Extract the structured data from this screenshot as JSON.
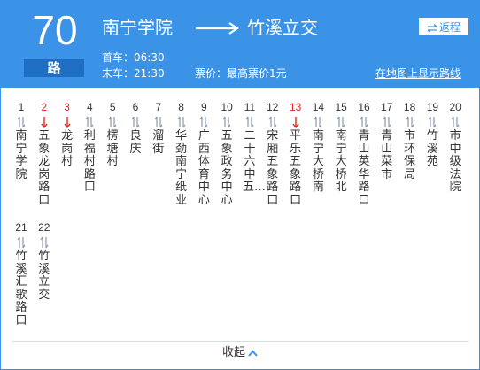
{
  "header": {
    "route_number": "70",
    "route_unit": "路",
    "from_stop": "南宁学院",
    "to_stop": "竹溪立交",
    "reverse_label": "返程",
    "first_bus": "首车：06:30",
    "last_bus": "末车：21:30",
    "price": "票价：最高票价1元",
    "map_link": "在地图上显示路线"
  },
  "stops": [
    {
      "num": "1",
      "name": "南宁学院",
      "red": false
    },
    {
      "num": "2",
      "name": "五象龙岗路口",
      "red": true
    },
    {
      "num": "3",
      "name": "龙岗村",
      "red": true
    },
    {
      "num": "4",
      "name": "利福村路口",
      "red": false
    },
    {
      "num": "5",
      "name": "楞塘村",
      "red": false
    },
    {
      "num": "6",
      "name": "良庆",
      "red": false
    },
    {
      "num": "7",
      "name": "溜街",
      "red": false
    },
    {
      "num": "8",
      "name": "华劲南宁纸业",
      "red": false
    },
    {
      "num": "9",
      "name": "广西体育中心",
      "red": false
    },
    {
      "num": "10",
      "name": "五象政务中心",
      "red": false
    },
    {
      "num": "11",
      "name": "二十六中五…",
      "red": false
    },
    {
      "num": "12",
      "name": "宋厢五象路口",
      "red": false
    },
    {
      "num": "13",
      "name": "平乐五象路口",
      "red": true
    },
    {
      "num": "14",
      "name": "南宁大桥南",
      "red": false
    },
    {
      "num": "15",
      "name": "南宁大桥北",
      "red": false
    },
    {
      "num": "16",
      "name": "青山英华路口",
      "red": false
    },
    {
      "num": "17",
      "name": "青山菜市",
      "red": false
    },
    {
      "num": "18",
      "name": "市环保局",
      "red": false
    },
    {
      "num": "19",
      "name": "竹溪苑",
      "red": false
    },
    {
      "num": "20",
      "name": "市中级法院",
      "red": false
    },
    {
      "num": "21",
      "name": "竹溪汇歌路口",
      "red": false
    },
    {
      "num": "22",
      "name": "竹溪立交",
      "red": false
    }
  ],
  "footer": {
    "collapse_label": "收起"
  },
  "colors": {
    "header_bg": "#3b93e8",
    "route_unit_bg": "#1e6fc3",
    "highlight_red": "#e0251f",
    "text": "#333333"
  }
}
